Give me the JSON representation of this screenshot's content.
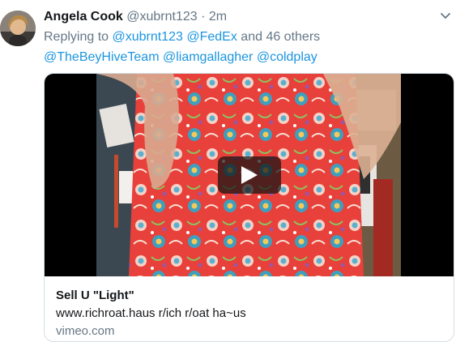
{
  "tweet": {
    "author_name": "Angela Cook",
    "author_handle": "@xubrnt123",
    "separator": "·",
    "time": "2m",
    "replying": {
      "prefix": "Replying to",
      "mention1": "@xubrnt123",
      "mention2": "@FedEx",
      "suffix": "and 46 others",
      "line2": [
        "@TheBeyHiveTeam",
        "@liamgallagher",
        "@coldplay"
      ]
    },
    "card": {
      "title": "Sell U \"Light\"",
      "description": "www.richroat.haus r/ich r/oat ha~us",
      "domain": "vimeo.com"
    }
  },
  "icons": {
    "menu": "chevron-down-icon",
    "play": "play-icon"
  },
  "colors": {
    "link": "#1b95e0",
    "muted": "#657786",
    "border": "#d6dfe5",
    "dress_red": "#e8403a"
  }
}
